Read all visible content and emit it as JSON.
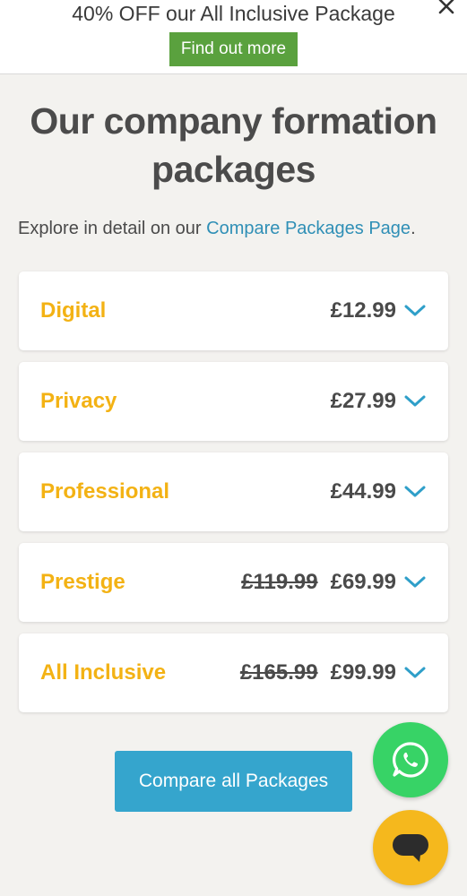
{
  "promo": {
    "text": "40% OFF our All Inclusive Package",
    "button_label": "Find out more",
    "close_icon": "close-icon"
  },
  "heading": {
    "title": "Our company formation packages"
  },
  "intro": {
    "text_before": "Explore in detail on our ",
    "link_text": "Compare Packages Page",
    "text_after": "."
  },
  "packages": [
    {
      "name": "Digital",
      "old_price": "",
      "price": "£12.99",
      "icon": "chevron-down-icon"
    },
    {
      "name": "Privacy",
      "old_price": "",
      "price": "£27.99",
      "icon": "chevron-down-icon"
    },
    {
      "name": "Professional",
      "old_price": "",
      "price": "£44.99",
      "icon": "chevron-down-icon"
    },
    {
      "name": "Prestige",
      "old_price": "£119.99",
      "price": "£69.99",
      "icon": "chevron-down-icon"
    },
    {
      "name": "All Inclusive",
      "old_price": "£165.99",
      "price": "£99.99",
      "icon": "chevron-down-icon"
    }
  ],
  "compare_button": {
    "label": "Compare all Packages"
  },
  "floating": {
    "whatsapp_icon": "whatsapp-icon",
    "chat_icon": "chat-bubble-icon"
  },
  "colors": {
    "accent_yellow": "#f3b214",
    "link_blue": "#2f8fb6",
    "button_blue": "#35a5cd",
    "promo_green": "#5aa13e",
    "whatsapp_green": "#37d366",
    "chat_yellow": "#f5b81d"
  }
}
